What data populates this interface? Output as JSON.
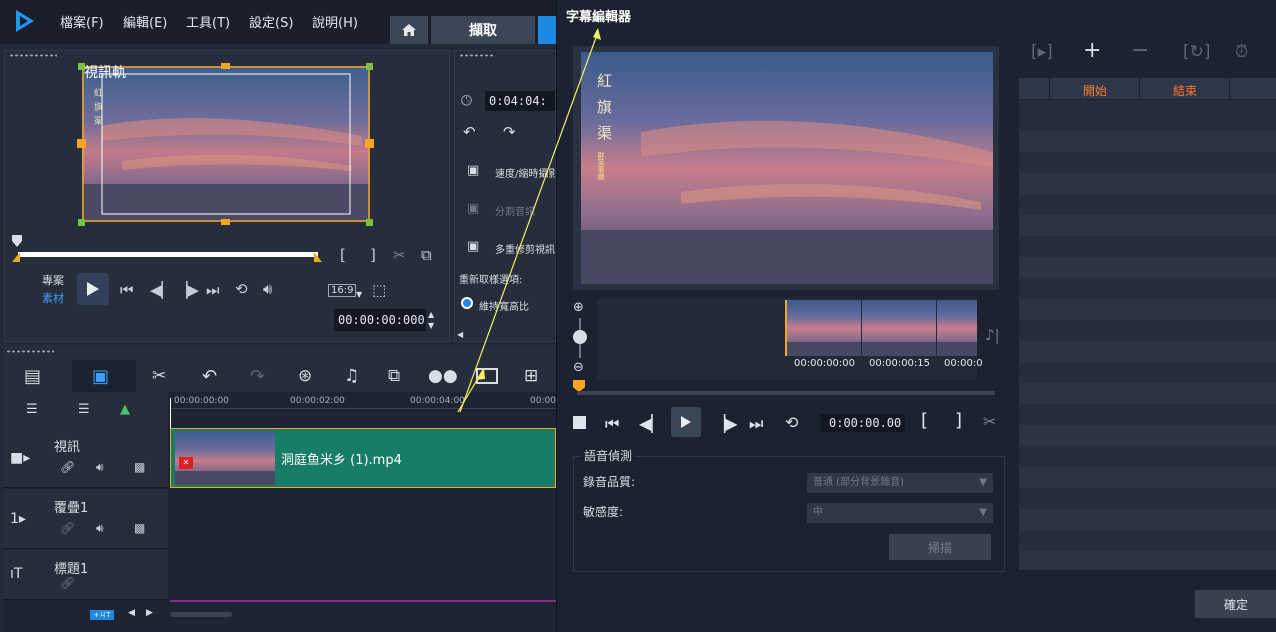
{
  "menu": {
    "items": [
      "檔案(F)",
      "編輯(E)",
      "工具(T)",
      "設定(S)",
      "說明(H)"
    ],
    "capture_tab": "擷取"
  },
  "preview": {
    "track_label": "視訊軌",
    "project_label": "專案",
    "clip_label": "素材",
    "aspect": "16:9",
    "timecode": "00:00:00:000",
    "mark_in": "[",
    "mark_out": "]"
  },
  "options_panel": {
    "duration": "0:04:04:",
    "speed_label": "速度/縮時攝影",
    "split_audio_label": "分割音訊",
    "multi_trim_label": "多重修剪視訊",
    "resample_label": "重新取樣選項:",
    "keep_aspect_label": "維持寬高比"
  },
  "timeline": {
    "ruler": [
      "00:00:00:00",
      "00:00:02:00",
      "00:00:04:00",
      "00:00:"
    ],
    "tracks": [
      {
        "name": "視訊",
        "icon": "video-track-icon"
      },
      {
        "name": "覆疊1",
        "icon": "overlay-track-icon"
      },
      {
        "name": "標題1",
        "icon": "title-track-icon"
      }
    ],
    "clip_name": "洞庭鱼米乡 (1).mp4",
    "clip_color": "#177c68",
    "add_track_label": "+ㄐT"
  },
  "dialog": {
    "title": "字幕編輯器",
    "thumb_times": [
      "00:00:00:00",
      "00:00:00:15",
      "00:00:0"
    ],
    "timecode": "0:00:00.00",
    "mark_in": "[",
    "mark_out": "]",
    "speech": {
      "legend": "語音偵測",
      "quality_label": "錄音品質:",
      "quality_value": "普通 (部分背景雜音)",
      "sensitivity_label": "敏感度:",
      "sensitivity_value": "中",
      "scan_label": "掃描"
    },
    "columns": [
      "開始",
      "結束"
    ],
    "ok_label": "確定"
  },
  "video_text": {
    "title_chars": [
      "紅",
      "旗",
      "渠"
    ],
    "subtitle": "群英事蹟"
  },
  "colors": {
    "accent_orange": "#ff7a2a",
    "accent_blue": "#1e88e5",
    "clip_teal": "#177c68",
    "annotation_yellow": "#f4f060"
  }
}
